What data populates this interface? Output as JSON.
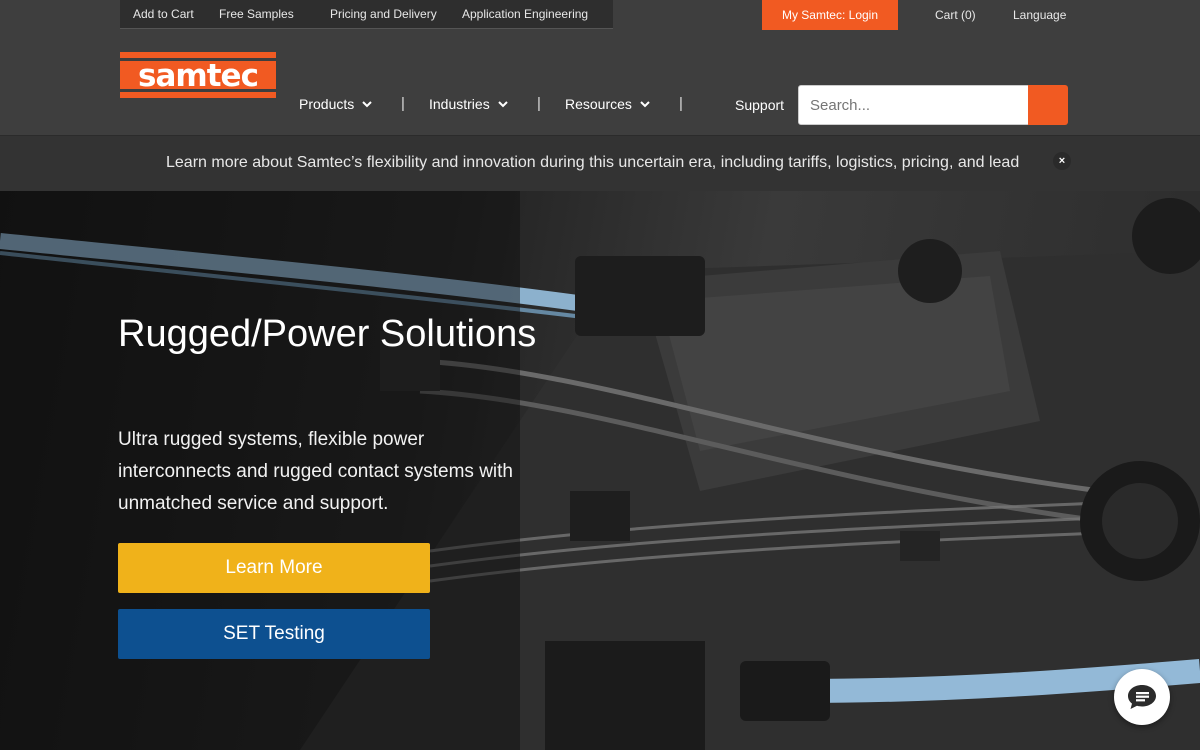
{
  "utility_bar": {
    "links": [
      "Add to Cart",
      "Free Samples",
      "Pricing and Delivery",
      "Application Engineering"
    ],
    "login": "My Samtec: Login",
    "cart": "Cart (0)",
    "language": "Language"
  },
  "header": {
    "logo_text": "samtec",
    "nav": [
      "Products",
      "Industries",
      "Resources",
      "Support"
    ],
    "separator": "|",
    "search_placeholder": "Search..."
  },
  "notice": {
    "text": "Learn more about Samtec’s flexibility and innovation during this uncertain era, including tariffs, logistics, pricing, and lead",
    "close": "×"
  },
  "hero": {
    "title": "Rugged/Power Solutions",
    "subtitle": "Ultra rugged systems, flexible power interconnects and rugged contact systems with unmatched service and support.",
    "primary_button": "Learn More",
    "secondary_button": "SET Testing"
  },
  "colors": {
    "brand_orange": "#f15a22",
    "learn_more_yellow": "#f0b21a",
    "set_testing_blue": "#0d5090",
    "bar_dark": "#3e3e3e"
  },
  "icons": [
    "chevron-down-icon",
    "search-icon",
    "close-icon",
    "chat-icon"
  ]
}
